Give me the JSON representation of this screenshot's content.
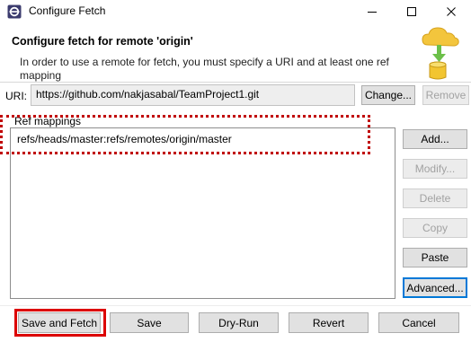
{
  "window": {
    "title": "Configure Fetch"
  },
  "header": {
    "title": "Configure fetch for remote 'origin'",
    "description": "In order to use a remote for fetch, you must specify a URI and at least one ref mapping",
    "icon": "fetch-cloud-database-icon"
  },
  "uri": {
    "label": "URI:",
    "value": "https://github.com/nakjasabal/TeamProject1.git",
    "change_label": "Change...",
    "remove_label": "Remove"
  },
  "ref_mappings": {
    "label": "Ref mappings",
    "items": [
      "refs/heads/master:refs/remotes/origin/master"
    ],
    "buttons": {
      "add": "Add...",
      "modify": "Modify...",
      "delete": "Delete",
      "copy": "Copy",
      "paste": "Paste",
      "advanced": "Advanced..."
    }
  },
  "footer": {
    "save_and_fetch": "Save and Fetch",
    "save": "Save",
    "dry_run": "Dry-Run",
    "revert": "Revert",
    "cancel": "Cancel"
  },
  "colors": {
    "highlight": "#d00000",
    "focus": "#0078d7"
  }
}
